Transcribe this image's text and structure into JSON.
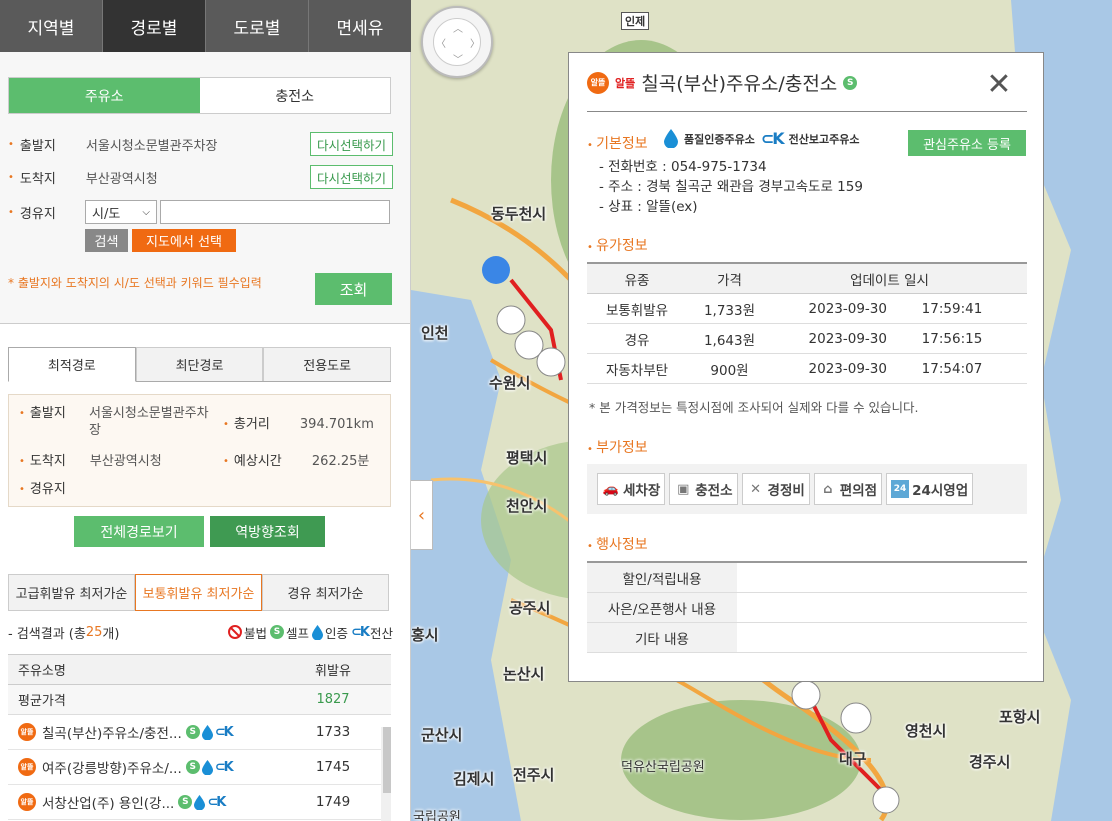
{
  "nav": {
    "tabs": [
      {
        "label": "지역별"
      },
      {
        "label": "경로별"
      },
      {
        "label": "도로별"
      },
      {
        "label": "면세유"
      }
    ]
  },
  "mode_tabs": [
    {
      "label": "주유소"
    },
    {
      "label": "충전소"
    }
  ],
  "form": {
    "origin_label": "출발지",
    "origin_value": "서울시청소문별관주차장",
    "dest_label": "도착지",
    "dest_value": "부산광역시청",
    "reselect_label": "다시선택하기",
    "via_label": "경유지",
    "sido_value": "시/도",
    "search_label": "검색",
    "map_select_label": "지도에서 선택",
    "notice": "* 출발지와 도착지의 시/도 선택과 키워드 필수입력",
    "submit_label": "조회"
  },
  "route_tabs": [
    {
      "label": "최적경로"
    },
    {
      "label": "최단경로"
    },
    {
      "label": "전용도로"
    }
  ],
  "route_summary": {
    "origin_label": "출발지",
    "origin_value": "서울시청소문별관주차장",
    "dest_label": "도착지",
    "dest_value": "부산광역시청",
    "via_label": "경유지",
    "distance_label": "총거리",
    "distance_value": "394.701km",
    "time_label": "예상시간",
    "time_value": "262.25분"
  },
  "route_buttons": {
    "full_route": "전체경로보기",
    "reverse": "역방향조회"
  },
  "fuel_tabs": [
    {
      "label": "고급휘발유 최저가순"
    },
    {
      "label": "보통휘발유 최저가순"
    },
    {
      "label": "경유 최저가순"
    }
  ],
  "results": {
    "prefix": "- 검색결과 (총 ",
    "count": "25",
    "suffix": "개)",
    "legend": {
      "illegal": "불법",
      "self": "셀프",
      "certified": "인증",
      "computerized": "전산"
    }
  },
  "result_table": {
    "col_name": "주유소명",
    "col_price": "휘발유",
    "avg_label": "평균가격",
    "avg_value": "1827",
    "rows": [
      {
        "name": "칠곡(부산)주유소/충전...",
        "price": "1733"
      },
      {
        "name": "여주(강릉방향)주유소/...",
        "price": "1745"
      },
      {
        "name": "서창산업(주) 용인(강...",
        "price": "1749"
      }
    ]
  },
  "map": {
    "labels": {
      "c1": "인제",
      "c2": "동두천시",
      "c3": "인천",
      "c4": "수원시",
      "c5": "평택시",
      "c6": "천안시",
      "c7": "공주시",
      "c8": "논산시",
      "c9": "군산시",
      "c10": "김제시",
      "c11": "전주시",
      "c12": "덕유산국립공원",
      "c13": "대구",
      "c14": "영천시",
      "c15": "포항시",
      "c16": "경주시",
      "c17": "국립공원",
      "c18": "홍시"
    }
  },
  "popup": {
    "brand": "알뜰",
    "title": "칠곡(부산)주유소/충전소",
    "section_basic": "기본정보",
    "badge_quality": "품질인증주유소",
    "badge_computerized": "전산보고주유소",
    "fav_button": "관심주유소 등록",
    "phone": "- 전화번호 : 054-975-1734",
    "address": "- 주소 : 경북 칠곡군 왜관읍 경부고속도로 159",
    "trademark": "- 상표 : 알뜰(ex)",
    "section_price": "유가정보",
    "price_head": {
      "type": "유종",
      "price": "가격",
      "updated": "업데이트 일시"
    },
    "prices": [
      {
        "type": "보통휘발유",
        "price": "1,733원",
        "date": "2023-09-30",
        "time": "17:59:41"
      },
      {
        "type": "경유",
        "price": "1,643원",
        "date": "2023-09-30",
        "time": "17:56:15"
      },
      {
        "type": "자동차부탄",
        "price": "900원",
        "date": "2023-09-30",
        "time": "17:54:07"
      }
    ],
    "price_note": "* 본 가격정보는 특정시점에 조사되어 실제와 다를 수 있습니다.",
    "section_extra": "부가정보",
    "extras": [
      {
        "label": "세차장",
        "icon": "car-wash-icon"
      },
      {
        "label": "충전소",
        "icon": "charger-icon"
      },
      {
        "label": "경정비",
        "icon": "wrench-icon"
      },
      {
        "label": "편의점",
        "icon": "store-icon"
      },
      {
        "label": "24시영업",
        "icon": "24h-icon"
      }
    ],
    "section_event": "행사정보",
    "events": [
      {
        "label": "할인/적립내용"
      },
      {
        "label": "사은/오픈행사 내용"
      },
      {
        "label": "기타 내용"
      }
    ]
  },
  "colors": {
    "accent_green": "#5cbd6e",
    "accent_orange": "#f06a12",
    "nav_dark": "#333333"
  }
}
